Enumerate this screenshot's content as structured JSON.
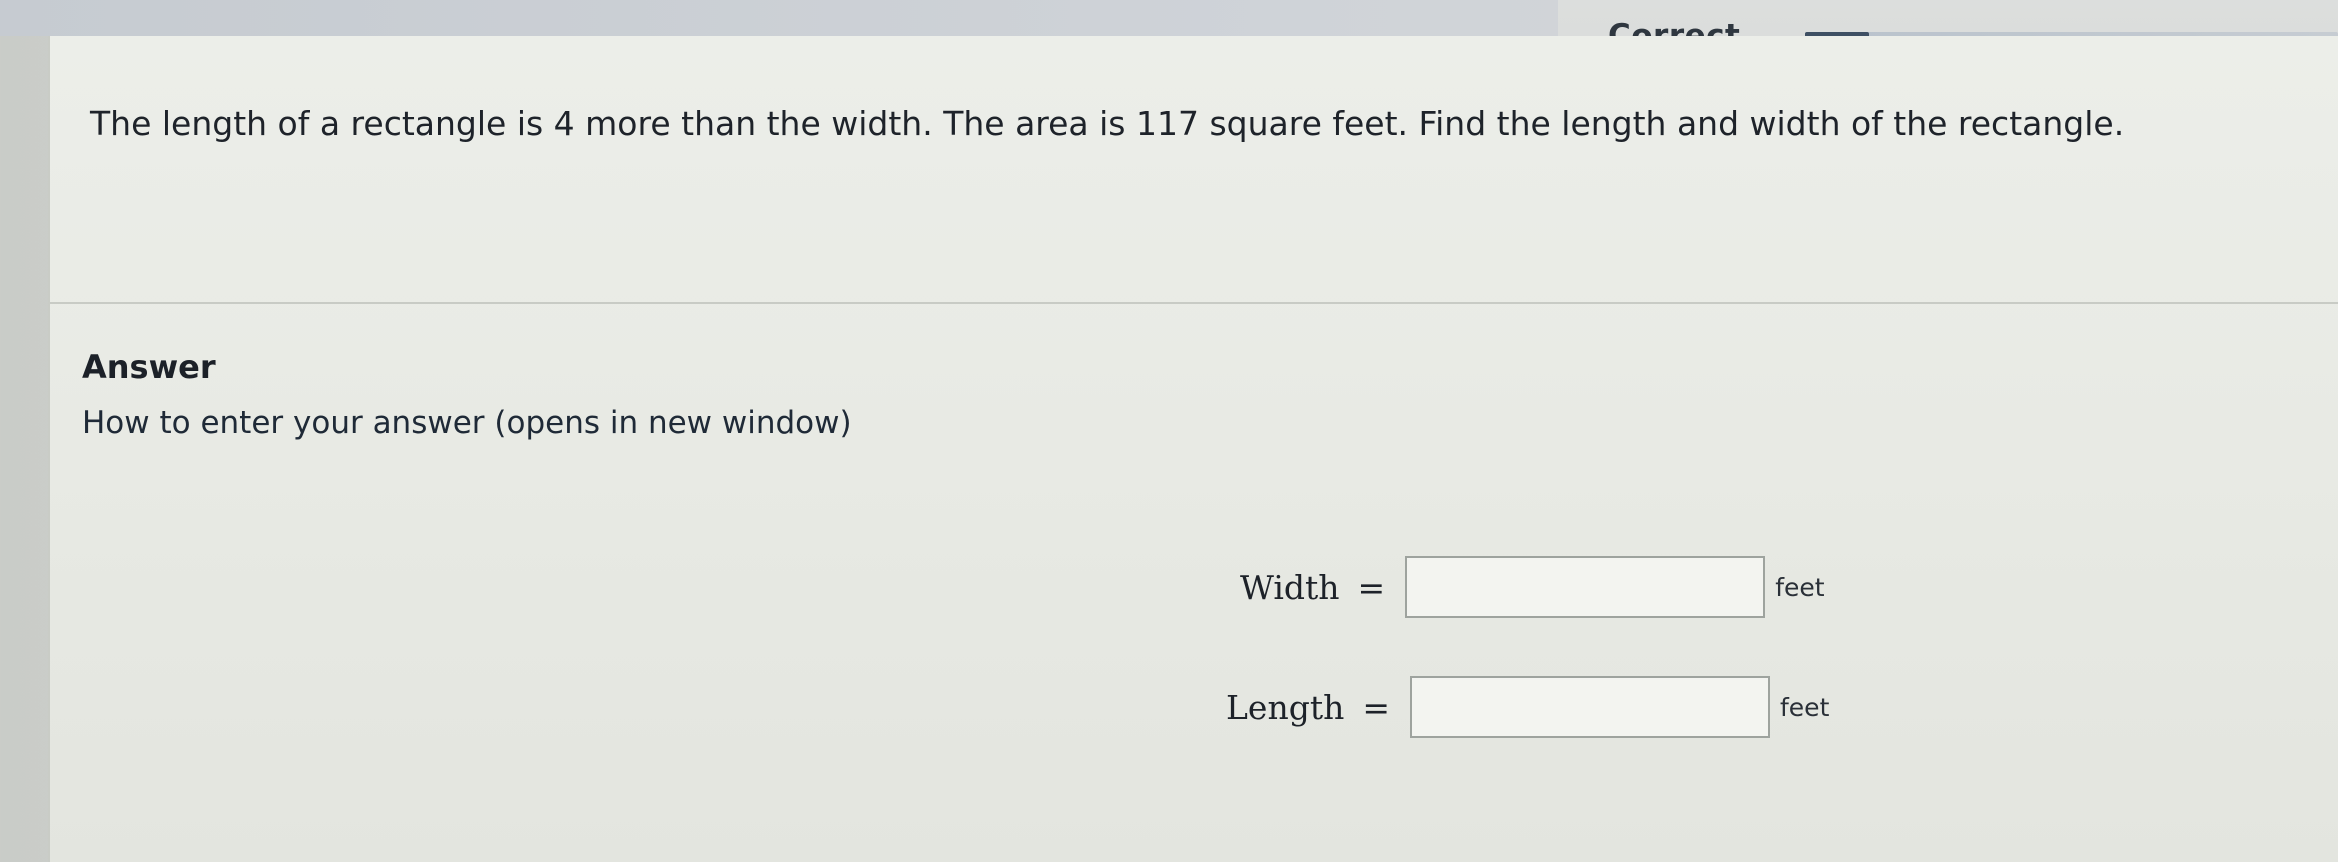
{
  "status": {
    "label": "Correct",
    "progress_fraction": 0.12
  },
  "question": {
    "text": "The length of a rectangle is 4 more than the width.  The area is 117 square feet.  Find the length and width of the rectangle."
  },
  "answer": {
    "heading": "Answer",
    "help_link": "How to enter your answer (opens in new window)",
    "fields": [
      {
        "label": "Width",
        "equals": "=",
        "value": "",
        "unit": "feet"
      },
      {
        "label": "Length",
        "equals": "=",
        "value": "",
        "unit": "feet"
      }
    ]
  },
  "colors": {
    "accent": "#3e4f63",
    "text": "#1e232a"
  }
}
